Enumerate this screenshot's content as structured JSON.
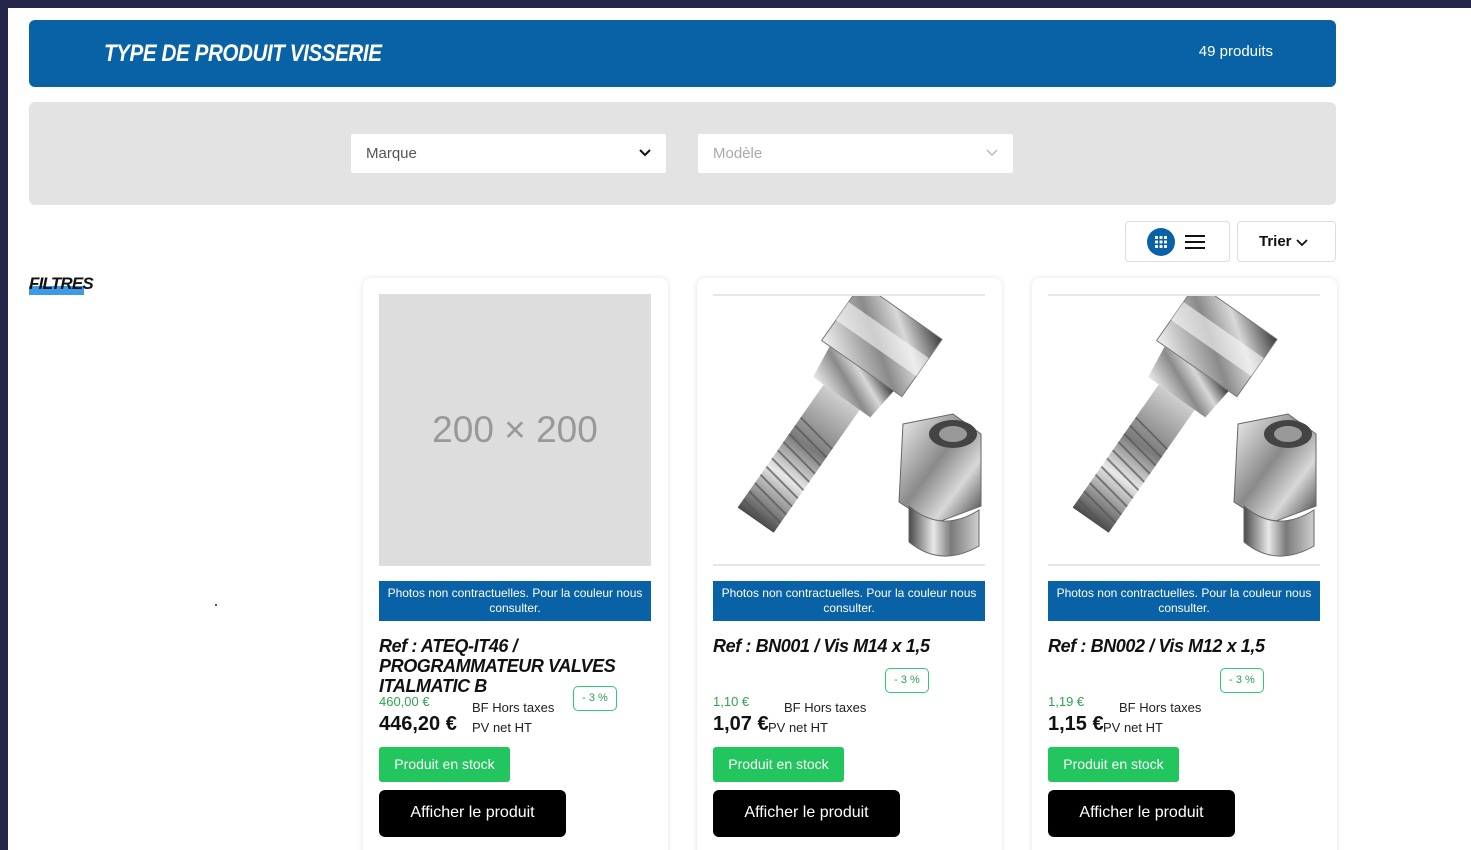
{
  "header": {
    "title": "TYPE DE PRODUIT VISSERIE",
    "count": "49 produits"
  },
  "filters_bar": {
    "brand": {
      "value": "Marque"
    },
    "model": {
      "value": "Modèle"
    }
  },
  "toolbar": {
    "sort_label": "Trier",
    "view_mode": "grid"
  },
  "sidebar": {
    "filters_title": "FILTRES"
  },
  "colors": {
    "brand_blue": "#0962a6",
    "stock_green": "#22c55e",
    "accent_blue": "#3d9be6"
  },
  "products": [
    {
      "placeholder": "200 × 200",
      "notice": "Photos non contractuelles. Pour la couleur nous consulter.",
      "title": "Ref : ATEQ-IT46 / PROGRAMMATEUR VALVES ITALMATIC B",
      "old_price": "460,00 €",
      "new_price": "446,20 €",
      "bf_label": "BF Hors taxes",
      "pv_label": "PV net HT",
      "discount": "- 3 %",
      "stock": "Produit en stock",
      "button": "Afficher le produit"
    },
    {
      "notice": "Photos non contractuelles. Pour la couleur nous consulter.",
      "title": "Ref : BN001 / Vis M14 x 1,5",
      "old_price": "1,10 €",
      "new_price": "1,07 €",
      "bf_label": "BF Hors taxes",
      "pv_label": "PV net HT",
      "discount": "- 3 %",
      "stock": "Produit en stock",
      "button": "Afficher le produit"
    },
    {
      "notice": "Photos non contractuelles. Pour la couleur nous consulter.",
      "title": "Ref : BN002 / Vis M12 x 1,5",
      "old_price": "1,19 €",
      "new_price": "1,15 €",
      "bf_label": "BF Hors taxes",
      "pv_label": "PV net HT",
      "discount": "- 3 %",
      "stock": "Produit en stock",
      "button": "Afficher le produit"
    }
  ]
}
